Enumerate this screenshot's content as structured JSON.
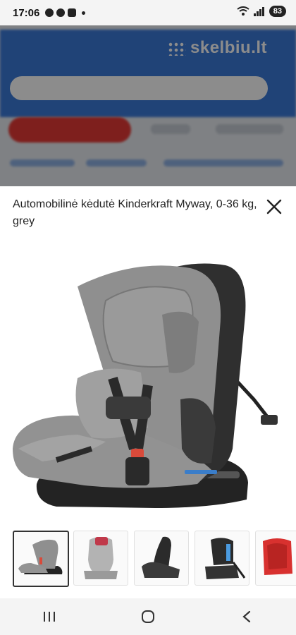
{
  "status_bar": {
    "time": "17:06",
    "battery": "83"
  },
  "background_site": {
    "logo_text": "skelbiu.lt"
  },
  "modal": {
    "title": "Automobilinė kėdutė Kinderkraft Myway, 0-36 kg, grey",
    "close_icon": "close-icon",
    "thumbnails": [
      {
        "name": "thumbnail-1",
        "variant": "grey-seat-angle",
        "active": true
      },
      {
        "name": "thumbnail-2",
        "variant": "grey-seat-front",
        "active": false
      },
      {
        "name": "thumbnail-3",
        "variant": "black-seat-reclined",
        "active": false
      },
      {
        "name": "thumbnail-4",
        "variant": "black-seat-isofix",
        "active": false
      },
      {
        "name": "thumbnail-5",
        "variant": "red-seat",
        "active": false
      }
    ]
  },
  "nav_bar": {
    "recents_icon": "recents-icon",
    "home_icon": "home-icon",
    "back_icon": "back-icon"
  },
  "colors": {
    "brand_blue": "#3b7ad9",
    "accent_red": "#e53935",
    "seat_grey": "#8c8c8c",
    "seat_dark": "#2b2b2b"
  }
}
